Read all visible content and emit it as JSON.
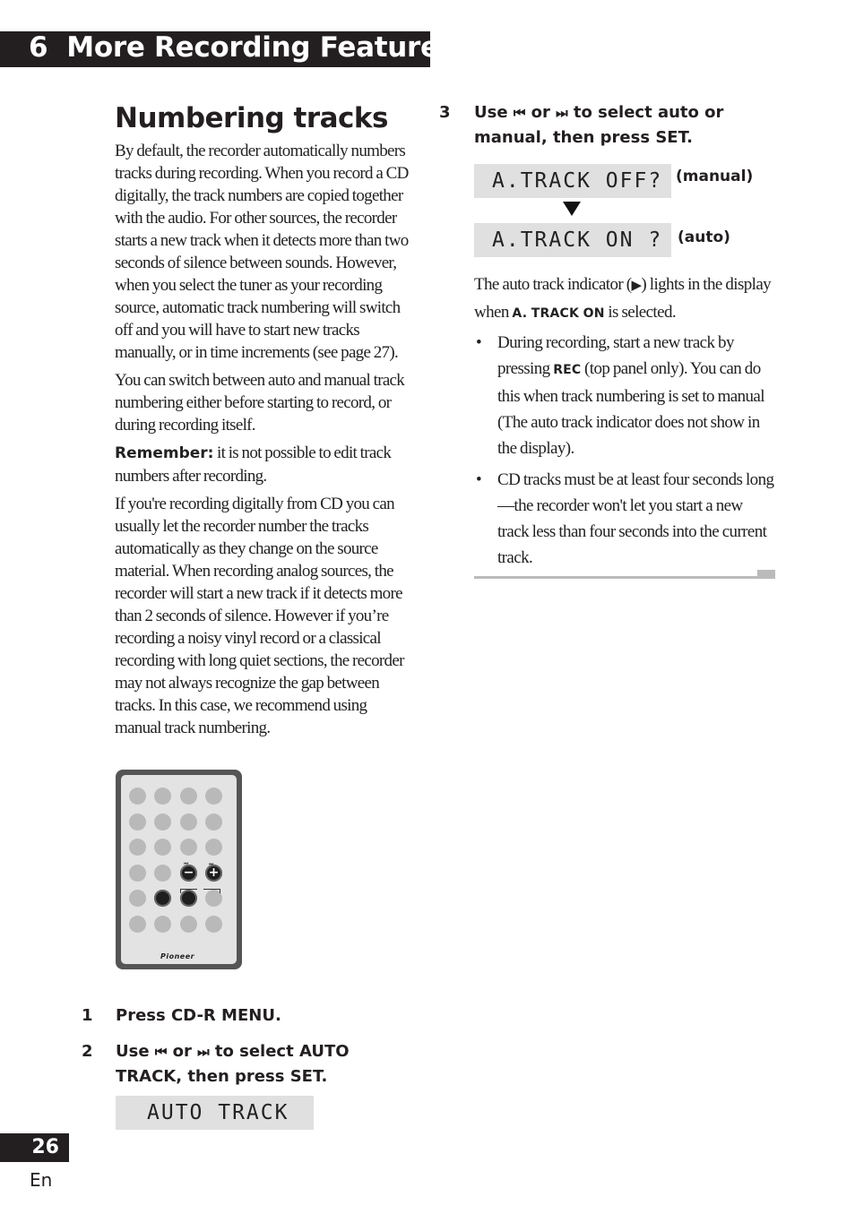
{
  "header": {
    "chapter_number": "6",
    "chapter_title": "More Recording Features"
  },
  "section": {
    "title": "Numbering tracks"
  },
  "left_column": {
    "paragraphs": [
      "By default, the recorder automatically numbers tracks during recording. When you record a CD digitally, the track numbers are copied together with the audio. For other sources, the recorder starts a new track when it detects more than two seconds of silence between sounds. However, when you select the tuner as your recording source, automatic track numbering will switch off and you will have to start new tracks manually, or in time increments (see page 27).",
      "You can switch between auto and manual track numbering either before starting to record, or during recording itself."
    ],
    "remember_label": "Remember:",
    "remember_text": " it is not possible to edit track numbers after recording.",
    "paragraph_digital": "If you're recording digitally from CD you can usually let the recorder number the tracks automatically as they change on the source material. When recording analog sources, the recorder will start a new track if it detects more than 2 seconds of silence. However if you’re recording a noisy vinyl record or a classical recording with long quiet sections, the recorder may not always recognize the gap between tracks. In this case, we recommend using manual track numbering."
  },
  "remote": {
    "brand": "Pioneer",
    "prev_symbol": "−",
    "next_symbol": "+",
    "prev_mark": "⏮",
    "next_mark": "⏭"
  },
  "steps": [
    {
      "number": "1",
      "text": "Press CD-R MENU."
    },
    {
      "number": "2",
      "text_before": "Use ",
      "prev_icon": "⏮",
      "or": " or ",
      "next_icon": "⏭",
      "text_after": " to select AUTO TRACK, then press SET.",
      "display": "AUTO TRACK"
    },
    {
      "number": "3",
      "text_before": "Use ",
      "prev_icon": "⏮",
      "or": " or ",
      "next_icon": "⏭",
      "text_after": " to select auto or manual, then press SET."
    }
  ],
  "displays": {
    "manual": {
      "text": "A.TRACK OFF?",
      "label": "(manual)"
    },
    "auto": {
      "text": "A.TRACK ON ?",
      "label": "(auto)"
    }
  },
  "right_column": {
    "indicator_text_1": "The auto track indicator (",
    "indicator_icon": "▶",
    "indicator_text_2": ") lights in the display when ",
    "indicator_bold": "A. TRACK ON",
    "indicator_text_3": " is selected.",
    "bullets": [
      {
        "before": "During recording, start a new track by pressing ",
        "bold": "REC",
        "after": "  (top panel only). You can do this when track numbering is set to manual (The auto track indicator does not show in the display)."
      },
      {
        "before": "CD tracks must be at least four seconds long—the recorder won't let you start a new track less than four seconds into the current track.",
        "bold": "",
        "after": ""
      }
    ],
    "bullet_symbol": "•"
  },
  "footer": {
    "page_number": "26",
    "language": "En"
  }
}
